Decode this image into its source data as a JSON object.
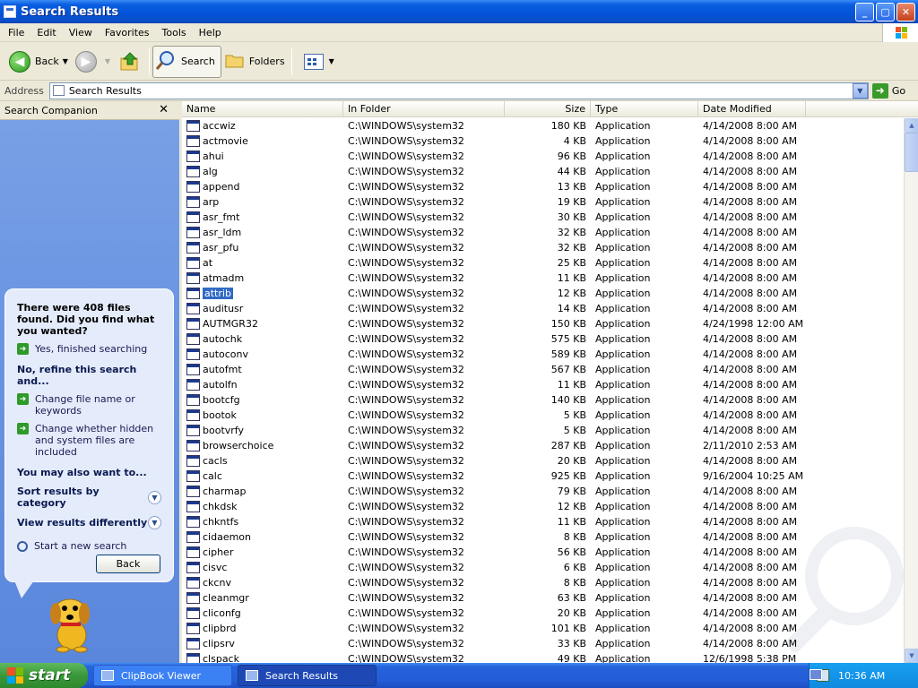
{
  "window": {
    "title": "Search Results"
  },
  "menu": [
    "File",
    "Edit",
    "View",
    "Favorites",
    "Tools",
    "Help"
  ],
  "toolbar": {
    "back": "Back",
    "search": "Search",
    "folders": "Folders"
  },
  "address": {
    "label": "Address",
    "value": "Search Results",
    "go": "Go"
  },
  "companion": {
    "title": "Search Companion",
    "found_text": "There were 408 files found. Did you find what you wanted?",
    "yes_finished": "Yes, finished searching",
    "refine_heading": "No, refine this search and...",
    "change_name": "Change file name or keywords",
    "change_hidden": "Change whether hidden and system files are included",
    "also_heading": "You may also want to...",
    "sort_results": "Sort results by category",
    "view_results": "View results differently",
    "new_search": "Start a new search",
    "back_button": "Back"
  },
  "columns": {
    "name": "Name",
    "folder": "In Folder",
    "size": "Size",
    "type": "Type",
    "date": "Date Modified"
  },
  "files": [
    {
      "name": "accwiz",
      "folder": "C:\\WINDOWS\\system32",
      "size": "180 KB",
      "type": "Application",
      "date": "4/14/2008 8:00 AM"
    },
    {
      "name": "actmovie",
      "folder": "C:\\WINDOWS\\system32",
      "size": "4 KB",
      "type": "Application",
      "date": "4/14/2008 8:00 AM"
    },
    {
      "name": "ahui",
      "folder": "C:\\WINDOWS\\system32",
      "size": "96 KB",
      "type": "Application",
      "date": "4/14/2008 8:00 AM"
    },
    {
      "name": "alg",
      "folder": "C:\\WINDOWS\\system32",
      "size": "44 KB",
      "type": "Application",
      "date": "4/14/2008 8:00 AM"
    },
    {
      "name": "append",
      "folder": "C:\\WINDOWS\\system32",
      "size": "13 KB",
      "type": "Application",
      "date": "4/14/2008 8:00 AM"
    },
    {
      "name": "arp",
      "folder": "C:\\WINDOWS\\system32",
      "size": "19 KB",
      "type": "Application",
      "date": "4/14/2008 8:00 AM"
    },
    {
      "name": "asr_fmt",
      "folder": "C:\\WINDOWS\\system32",
      "size": "30 KB",
      "type": "Application",
      "date": "4/14/2008 8:00 AM"
    },
    {
      "name": "asr_ldm",
      "folder": "C:\\WINDOWS\\system32",
      "size": "32 KB",
      "type": "Application",
      "date": "4/14/2008 8:00 AM"
    },
    {
      "name": "asr_pfu",
      "folder": "C:\\WINDOWS\\system32",
      "size": "32 KB",
      "type": "Application",
      "date": "4/14/2008 8:00 AM"
    },
    {
      "name": "at",
      "folder": "C:\\WINDOWS\\system32",
      "size": "25 KB",
      "type": "Application",
      "date": "4/14/2008 8:00 AM"
    },
    {
      "name": "atmadm",
      "folder": "C:\\WINDOWS\\system32",
      "size": "11 KB",
      "type": "Application",
      "date": "4/14/2008 8:00 AM"
    },
    {
      "name": "attrib",
      "folder": "C:\\WINDOWS\\system32",
      "size": "12 KB",
      "type": "Application",
      "date": "4/14/2008 8:00 AM",
      "selected": true
    },
    {
      "name": "auditusr",
      "folder": "C:\\WINDOWS\\system32",
      "size": "14 KB",
      "type": "Application",
      "date": "4/14/2008 8:00 AM"
    },
    {
      "name": "AUTMGR32",
      "folder": "C:\\WINDOWS\\system32",
      "size": "150 KB",
      "type": "Application",
      "date": "4/24/1998 12:00 AM"
    },
    {
      "name": "autochk",
      "folder": "C:\\WINDOWS\\system32",
      "size": "575 KB",
      "type": "Application",
      "date": "4/14/2008 8:00 AM"
    },
    {
      "name": "autoconv",
      "folder": "C:\\WINDOWS\\system32",
      "size": "589 KB",
      "type": "Application",
      "date": "4/14/2008 8:00 AM"
    },
    {
      "name": "autofmt",
      "folder": "C:\\WINDOWS\\system32",
      "size": "567 KB",
      "type": "Application",
      "date": "4/14/2008 8:00 AM"
    },
    {
      "name": "autolfn",
      "folder": "C:\\WINDOWS\\system32",
      "size": "11 KB",
      "type": "Application",
      "date": "4/14/2008 8:00 AM"
    },
    {
      "name": "bootcfg",
      "folder": "C:\\WINDOWS\\system32",
      "size": "140 KB",
      "type": "Application",
      "date": "4/14/2008 8:00 AM"
    },
    {
      "name": "bootok",
      "folder": "C:\\WINDOWS\\system32",
      "size": "5 KB",
      "type": "Application",
      "date": "4/14/2008 8:00 AM"
    },
    {
      "name": "bootvrfy",
      "folder": "C:\\WINDOWS\\system32",
      "size": "5 KB",
      "type": "Application",
      "date": "4/14/2008 8:00 AM"
    },
    {
      "name": "browserchoice",
      "folder": "C:\\WINDOWS\\system32",
      "size": "287 KB",
      "type": "Application",
      "date": "2/11/2010 2:53 AM"
    },
    {
      "name": "cacls",
      "folder": "C:\\WINDOWS\\system32",
      "size": "20 KB",
      "type": "Application",
      "date": "4/14/2008 8:00 AM"
    },
    {
      "name": "calc",
      "folder": "C:\\WINDOWS\\system32",
      "size": "925 KB",
      "type": "Application",
      "date": "9/16/2004 10:25 AM"
    },
    {
      "name": "charmap",
      "folder": "C:\\WINDOWS\\system32",
      "size": "79 KB",
      "type": "Application",
      "date": "4/14/2008 8:00 AM"
    },
    {
      "name": "chkdsk",
      "folder": "C:\\WINDOWS\\system32",
      "size": "12 KB",
      "type": "Application",
      "date": "4/14/2008 8:00 AM"
    },
    {
      "name": "chkntfs",
      "folder": "C:\\WINDOWS\\system32",
      "size": "11 KB",
      "type": "Application",
      "date": "4/14/2008 8:00 AM"
    },
    {
      "name": "cidaemon",
      "folder": "C:\\WINDOWS\\system32",
      "size": "8 KB",
      "type": "Application",
      "date": "4/14/2008 8:00 AM"
    },
    {
      "name": "cipher",
      "folder": "C:\\WINDOWS\\system32",
      "size": "56 KB",
      "type": "Application",
      "date": "4/14/2008 8:00 AM"
    },
    {
      "name": "cisvc",
      "folder": "C:\\WINDOWS\\system32",
      "size": "6 KB",
      "type": "Application",
      "date": "4/14/2008 8:00 AM"
    },
    {
      "name": "ckcnv",
      "folder": "C:\\WINDOWS\\system32",
      "size": "8 KB",
      "type": "Application",
      "date": "4/14/2008 8:00 AM"
    },
    {
      "name": "cleanmgr",
      "folder": "C:\\WINDOWS\\system32",
      "size": "63 KB",
      "type": "Application",
      "date": "4/14/2008 8:00 AM"
    },
    {
      "name": "cliconfg",
      "folder": "C:\\WINDOWS\\system32",
      "size": "20 KB",
      "type": "Application",
      "date": "4/14/2008 8:00 AM"
    },
    {
      "name": "clipbrd",
      "folder": "C:\\WINDOWS\\system32",
      "size": "101 KB",
      "type": "Application",
      "date": "4/14/2008 8:00 AM"
    },
    {
      "name": "clipsrv",
      "folder": "C:\\WINDOWS\\system32",
      "size": "33 KB",
      "type": "Application",
      "date": "4/14/2008 8:00 AM"
    },
    {
      "name": "clspack",
      "folder": "C:\\WINDOWS\\system32",
      "size": "49 KB",
      "type": "Application",
      "date": "12/6/1998 5:38 PM"
    }
  ],
  "taskbar": {
    "start": "start",
    "tasks": [
      {
        "label": "ClipBook Viewer",
        "active": false
      },
      {
        "label": "Search Results",
        "active": true
      }
    ],
    "clock": "10:36 AM"
  }
}
